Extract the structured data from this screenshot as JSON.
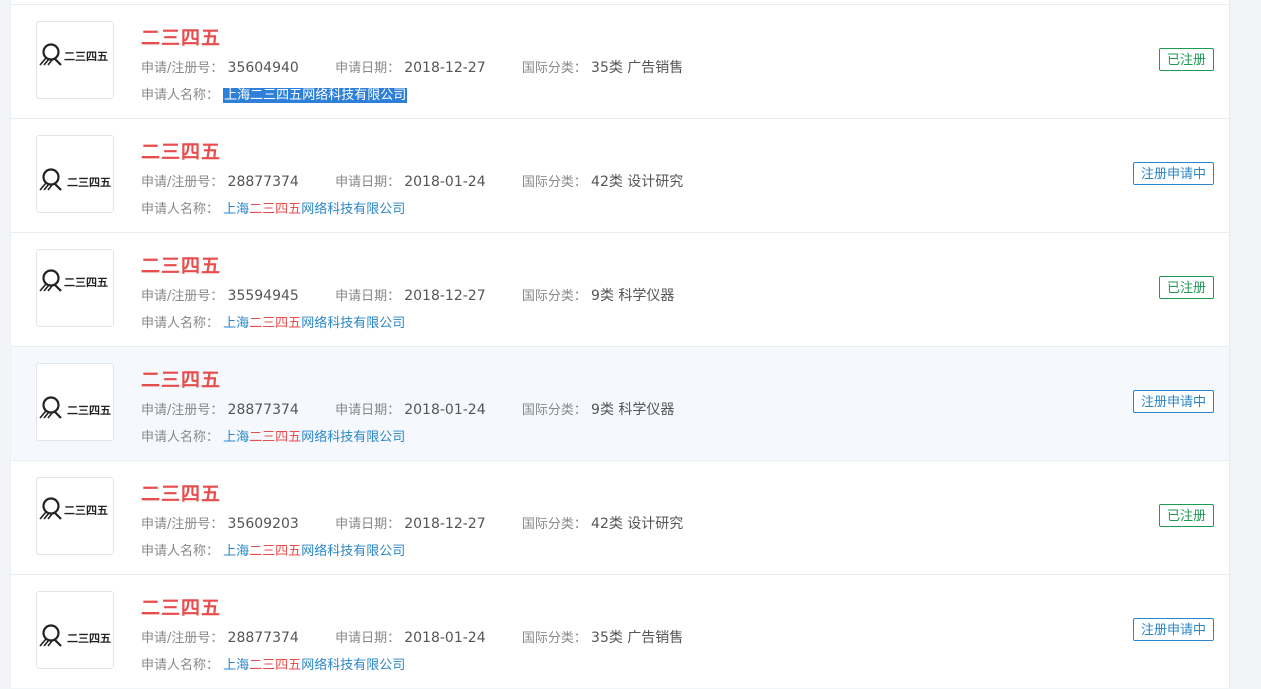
{
  "labels": {
    "reg_no": "申请/注册号：",
    "apply_date": "申请日期：",
    "intl_class": "国际分类：",
    "applicant": "申请人名称："
  },
  "logo_text": "二三四五",
  "colors": {
    "title_red": "#e84c4c",
    "link_blue": "#2a86c8",
    "status_green": "#1e9a53",
    "selection_blue": "#2d7fd8"
  },
  "items": [
    {
      "name": "二三四五",
      "reg_no": "35604940",
      "date": "2018-12-27",
      "cls": "35类 广告销售",
      "applicant": "上海二三四五网络科技有限公司",
      "applicant_pre": "上海",
      "applicant_hl": "二三四五",
      "applicant_post": "网络科技有限公司",
      "status": "已注册",
      "selected": true
    },
    {
      "name": "二三四五",
      "reg_no": "28877374",
      "date": "2018-01-24",
      "cls": "42类 设计研究",
      "applicant_pre": "上海",
      "applicant_hl": "二三四五",
      "applicant_post": "网络科技有限公司",
      "status": "注册申请中"
    },
    {
      "name": "二三四五",
      "reg_no": "35594945",
      "date": "2018-12-27",
      "cls": "9类 科学仪器",
      "applicant_pre": "上海",
      "applicant_hl": "二三四五",
      "applicant_post": "网络科技有限公司",
      "status": "已注册"
    },
    {
      "name": "二三四五",
      "reg_no": "28877374",
      "date": "2018-01-24",
      "cls": "9类 科学仪器",
      "applicant_pre": "上海",
      "applicant_hl": "二三四五",
      "applicant_post": "网络科技有限公司",
      "status": "注册申请中"
    },
    {
      "name": "二三四五",
      "reg_no": "35609203",
      "date": "2018-12-27",
      "cls": "42类 设计研究",
      "applicant_pre": "上海",
      "applicant_hl": "二三四五",
      "applicant_post": "网络科技有限公司",
      "status": "已注册"
    },
    {
      "name": "二三四五",
      "reg_no": "28877374",
      "date": "2018-01-24",
      "cls": "35类 广告销售",
      "applicant_pre": "上海",
      "applicant_hl": "二三四五",
      "applicant_post": "网络科技有限公司",
      "status": "注册申请中"
    }
  ]
}
